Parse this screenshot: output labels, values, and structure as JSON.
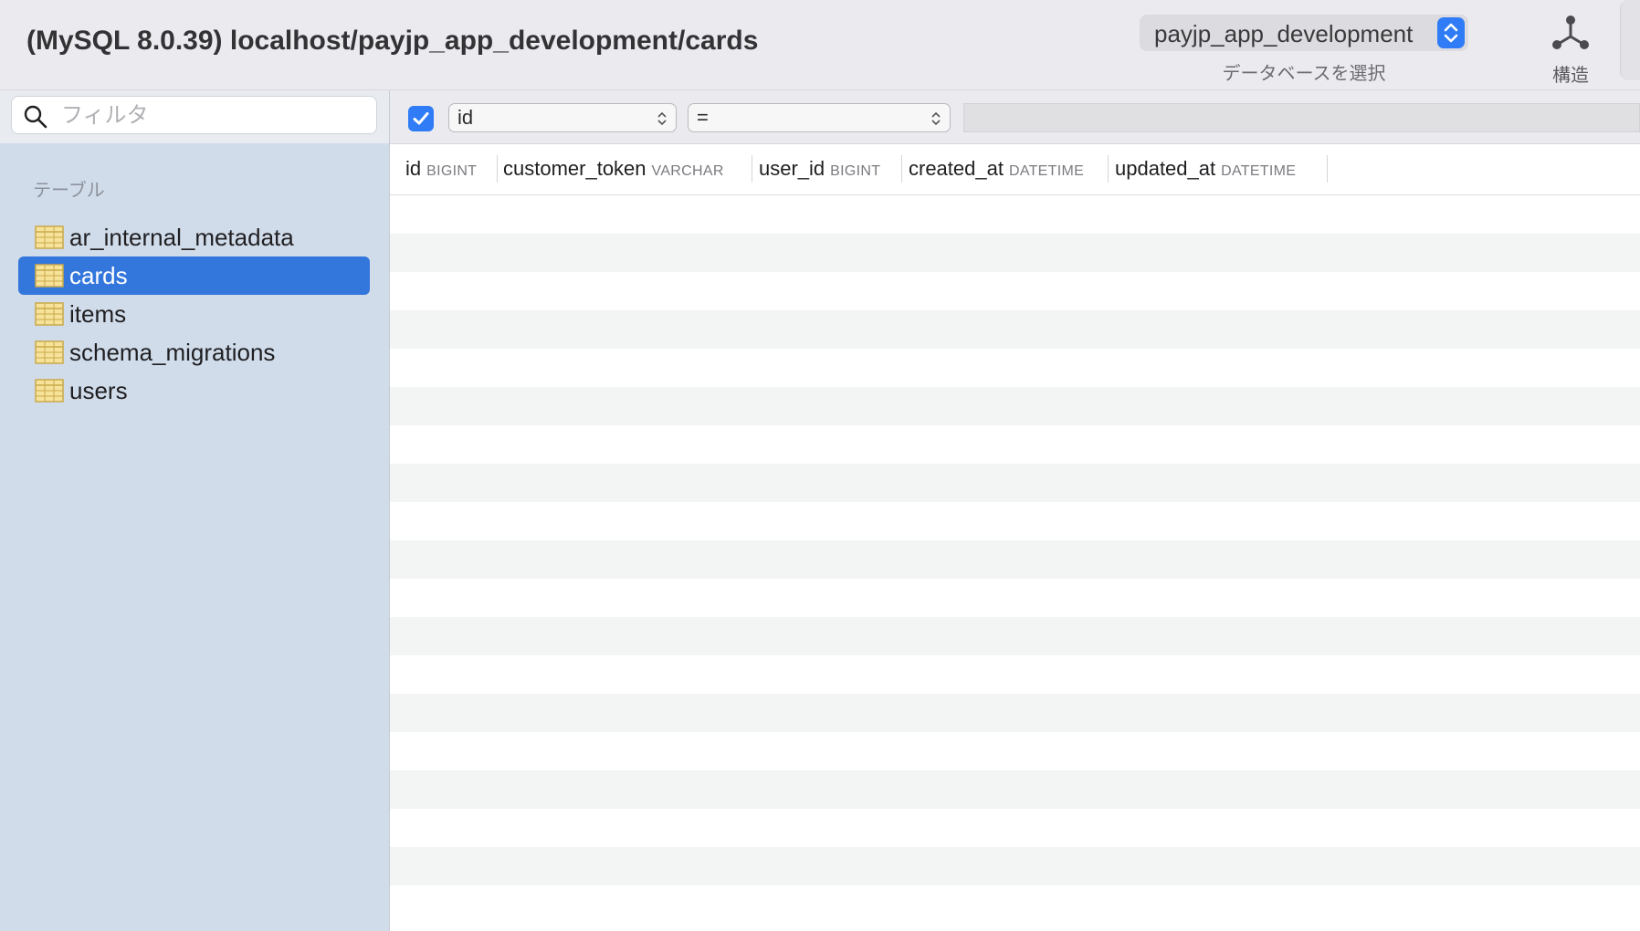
{
  "toolbar": {
    "title": "(MySQL 8.0.39) localhost/payjp_app_development/cards",
    "database_select": {
      "value": "payjp_app_development",
      "caption": "データベースを選択"
    },
    "structure_button": {
      "label": "構造",
      "icon": "structure-icon"
    }
  },
  "sidebar": {
    "filter_placeholder": "フィルタ",
    "section_title": "テーブル",
    "tables": [
      {
        "name": "ar_internal_metadata",
        "selected": false
      },
      {
        "name": "cards",
        "selected": true
      },
      {
        "name": "items",
        "selected": false
      },
      {
        "name": "schema_migrations",
        "selected": false
      },
      {
        "name": "users",
        "selected": false
      }
    ]
  },
  "filter_bar": {
    "enabled": true,
    "column": "id",
    "operator": "="
  },
  "columns": [
    {
      "name": "id",
      "type": "BIGINT"
    },
    {
      "name": "customer_token",
      "type": "VARCHAR"
    },
    {
      "name": "user_id",
      "type": "BIGINT"
    },
    {
      "name": "created_at",
      "type": "DATETIME"
    },
    {
      "name": "updated_at",
      "type": "DATETIME"
    }
  ],
  "colors": {
    "accent": "#2f7cf6",
    "selection": "#3477dc",
    "sidebar_bg": "#d1dcea"
  }
}
